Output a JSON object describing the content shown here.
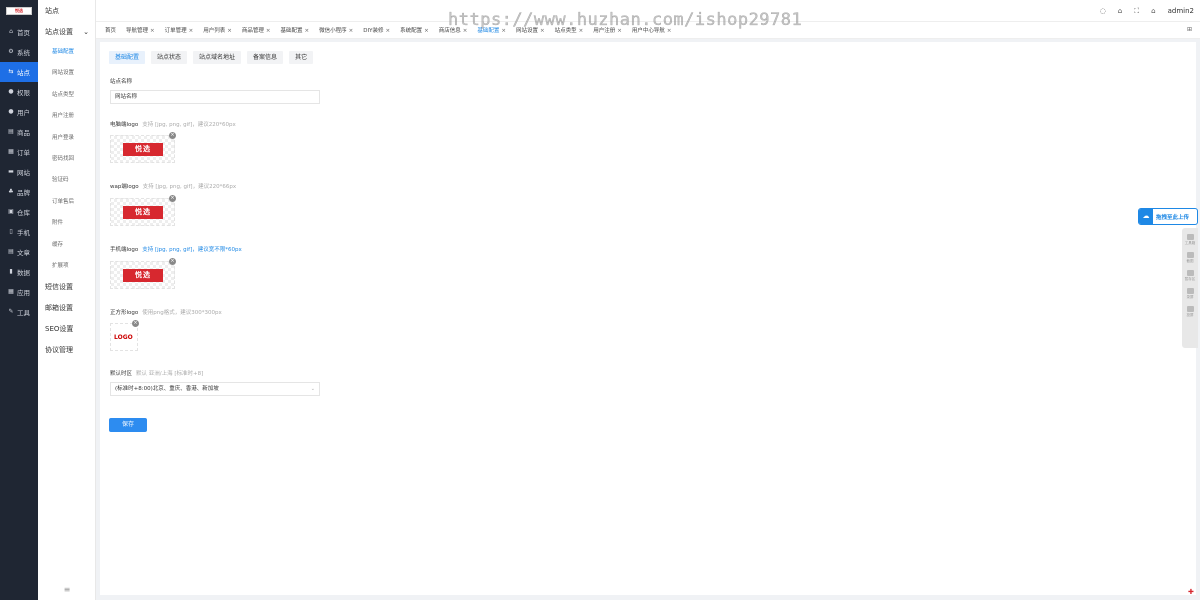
{
  "app": {
    "logo_text": "悦选",
    "watermark": "https://www.huzhan.com/ishop29781",
    "user": "admin2"
  },
  "sidebar": {
    "items": [
      {
        "label": "首页",
        "icon": "home-icon",
        "glyph": "⌂"
      },
      {
        "label": "系统",
        "icon": "gear-icon",
        "glyph": "⚙"
      },
      {
        "label": "站点",
        "icon": "site-icon",
        "glyph": "⇆",
        "active": true
      },
      {
        "label": "权限",
        "icon": "user-icon",
        "glyph": "●"
      },
      {
        "label": "用户",
        "icon": "user-icon",
        "glyph": "●"
      },
      {
        "label": "商品",
        "icon": "goods-icon",
        "glyph": "▤"
      },
      {
        "label": "订单",
        "icon": "order-icon",
        "glyph": "▦"
      },
      {
        "label": "网站",
        "icon": "web-icon",
        "glyph": "▬"
      },
      {
        "label": "品牌",
        "icon": "brand-icon",
        "glyph": "♣"
      },
      {
        "label": "仓库",
        "icon": "warehouse-icon",
        "glyph": "▣"
      },
      {
        "label": "手机",
        "icon": "phone-icon",
        "glyph": "▯"
      },
      {
        "label": "文章",
        "icon": "article-icon",
        "glyph": "▤"
      },
      {
        "label": "数据",
        "icon": "chart-icon",
        "glyph": "▮"
      },
      {
        "label": "应用",
        "icon": "apps-icon",
        "glyph": "▦"
      },
      {
        "label": "工具",
        "icon": "tool-icon",
        "glyph": "✎"
      }
    ]
  },
  "submenu": {
    "header": "站点",
    "group": "站点设置",
    "leaves": [
      "基础配置",
      "网站设置",
      "站点类型",
      "用户注册",
      "用户登录",
      "密码找回",
      "验证码",
      "订单售后",
      "附件",
      "缓存",
      "扩展项"
    ],
    "top_items": [
      "短信设置",
      "邮箱设置",
      "SEO设置",
      "协议管理"
    ],
    "collapse_glyph": "≡"
  },
  "tabs": [
    {
      "label": "首页",
      "closable": false
    },
    {
      "label": "导航管理",
      "closable": true
    },
    {
      "label": "订单管理",
      "closable": true
    },
    {
      "label": "用户列表",
      "closable": true
    },
    {
      "label": "商品管理",
      "closable": true
    },
    {
      "label": "基础配置",
      "closable": true
    },
    {
      "label": "微信小程序",
      "closable": true
    },
    {
      "label": "DIY装修",
      "closable": true
    },
    {
      "label": "系统配置",
      "closable": true
    },
    {
      "label": "商店信息",
      "closable": true
    },
    {
      "label": "基础配置",
      "closable": true,
      "active": true
    },
    {
      "label": "网站设置",
      "closable": true
    },
    {
      "label": "站点类型",
      "closable": true
    },
    {
      "label": "用户注册",
      "closable": true
    },
    {
      "label": "用户中心导航",
      "closable": true
    }
  ],
  "subtabs": [
    "基础配置",
    "站点状态",
    "站点域名地址",
    "备案信息",
    "其它"
  ],
  "form": {
    "site_name_label": "站点名称",
    "site_name_value": "网站名称",
    "pc_logo_label": "电脑端logo",
    "pc_logo_hint": "支持 [jpg, png, gif]，建议220*60px",
    "wap_logo_label": "wap端logo",
    "wap_logo_hint": "支持 [jpg, png, gif]，建议220*66px",
    "app_logo_label": "手机端logo",
    "app_logo_hint": "支持 [jpg, png, gif]，建议宽不限*60px",
    "square_logo_label": "正方形logo",
    "square_logo_hint": "使用png格式，建议300*300px",
    "square_logo_text": "LOGO",
    "timezone_label": "默认时区",
    "timezone_hint": "默认 亚洲/上海 [标准时+8]",
    "timezone_value": "(标准时+8:00)北京、重庆、香港、新加坡",
    "save": "保存",
    "delete_glyph": "×"
  },
  "float": {
    "upload_label": "拖拽至此上传",
    "tools": [
      "工具箱",
      "截图",
      "暂存区",
      "录屏",
      "投屏"
    ]
  },
  "colors": {
    "sidebar_bg": "#1f2633",
    "accent": "#1e88e5",
    "active_nav": "#1e6fe6",
    "brand_red": "#d7282f",
    "save_button": "#2d8cf0"
  }
}
